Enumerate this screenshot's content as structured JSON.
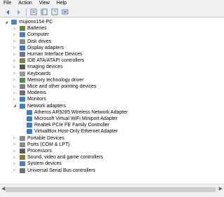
{
  "menubar": {
    "items": [
      "File",
      "Action",
      "View",
      "Help"
    ]
  },
  "toolbar": {
    "buttons": [
      "back-icon",
      "forward-icon",
      "properties-icon",
      "show-hide-icon",
      "help-icon",
      "scan-hardware-icon"
    ]
  },
  "tree": {
    "root": "mujiono154-PC",
    "categories": [
      {
        "label": "Batteries",
        "icon": "battery-icon",
        "color": "#5a8a3a"
      },
      {
        "label": "Computer",
        "icon": "computer-icon",
        "color": "#4f7fbf"
      },
      {
        "label": "Disk drives",
        "icon": "disk-icon",
        "color": "#8a8a8a"
      },
      {
        "label": "Display adapters",
        "icon": "display-icon",
        "color": "#3b78c4"
      },
      {
        "label": "Human Interface Devices",
        "icon": "hid-icon",
        "color": "#7a6aa8"
      },
      {
        "label": "IDE ATA/ATAPI controllers",
        "icon": "ide-icon",
        "color": "#6c8c3a"
      },
      {
        "label": "Imaging devices",
        "icon": "camera-icon",
        "color": "#555555"
      },
      {
        "label": "Keyboards",
        "icon": "keyboard-icon",
        "color": "#9a9a9a"
      },
      {
        "label": "Memory technology driver",
        "icon": "memory-icon",
        "color": "#4f8a4f"
      },
      {
        "label": "Mice and other pointing devices",
        "icon": "mouse-icon",
        "color": "#7f7f7f"
      },
      {
        "label": "Modems",
        "icon": "modem-icon",
        "color": "#6f6f6f"
      },
      {
        "label": "Monitors",
        "icon": "monitor-icon",
        "color": "#3d7cc9"
      },
      {
        "label": "Network adapters",
        "icon": "network-icon",
        "color": "#3d7cc9",
        "expanded": true,
        "children": [
          "Atheros AR9285 Wireless Network Adapter",
          "Microsoft Virtual WiFi Miniport Adapter",
          "Realtek PCIe FE Family Controller",
          "VirtualBox Host-Only Ethernet Adapter"
        ]
      },
      {
        "label": "Portable Devices",
        "icon": "portable-icon",
        "color": "#8a8a8a"
      },
      {
        "label": "Ports (COM & LPT)",
        "icon": "port-icon",
        "color": "#8a8a8a"
      },
      {
        "label": "Processors",
        "icon": "cpu-icon",
        "color": "#5a5a5a"
      },
      {
        "label": "Sound, video and game controllers",
        "icon": "sound-icon",
        "color": "#8a7a3a"
      },
      {
        "label": "System devices",
        "icon": "system-icon",
        "color": "#4f7fbf"
      },
      {
        "label": "Universal Serial Bus controllers",
        "icon": "usb-icon",
        "color": "#6f6f6f"
      }
    ]
  }
}
